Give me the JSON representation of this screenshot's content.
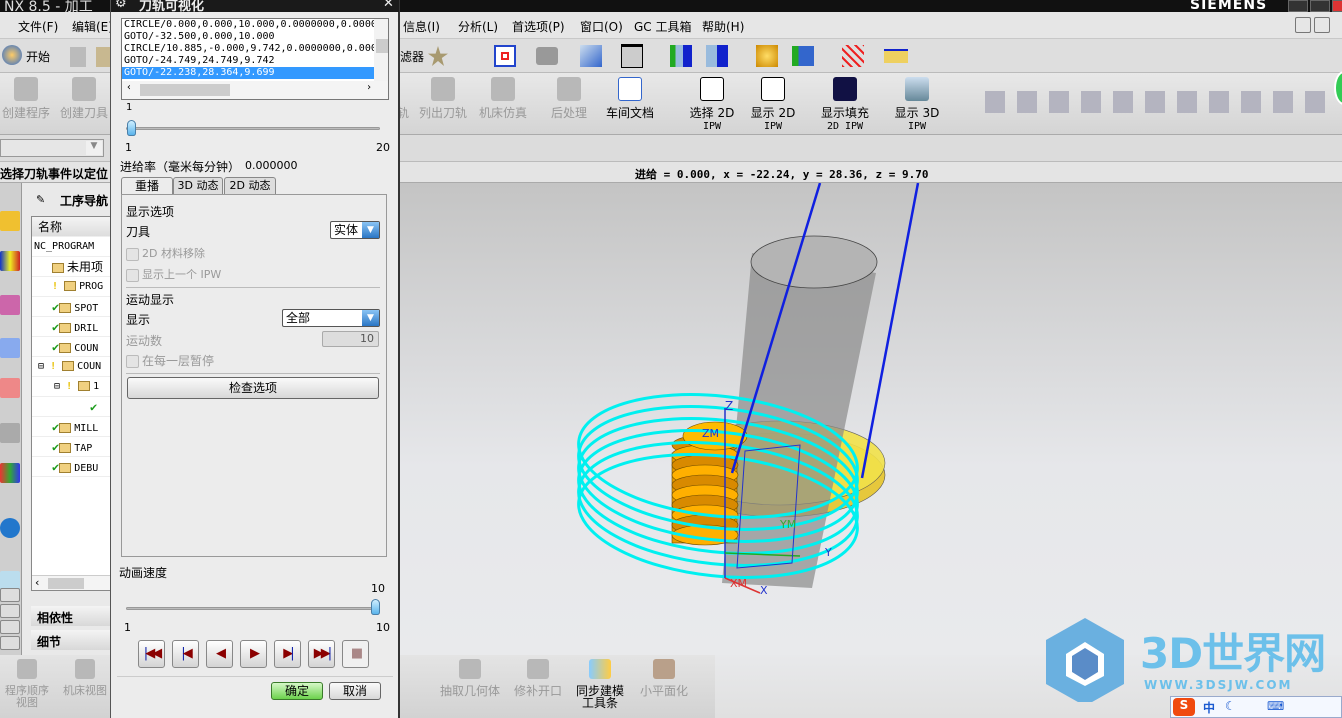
{
  "window": {
    "title": "NX 8.5 - 加工",
    "brand": "SIEMENS"
  },
  "menu": [
    "文件(F)",
    "编辑(E)",
    "信息(I)",
    "分析(L)",
    "首选项(P)",
    "窗口(O)",
    "GC 工具箱",
    "帮助(H)"
  ],
  "toolbar1": {
    "start": "开始",
    "filter_fragment": "滤器"
  },
  "toolbar2": {
    "items": [
      {
        "label": "创建程序",
        "enabled": false
      },
      {
        "label": "创建刀具",
        "enabled": false
      },
      {
        "label": "轨",
        "enabled": false
      },
      {
        "label": "列出刀轨",
        "enabled": false
      },
      {
        "label": "机床仿真",
        "enabled": false
      },
      {
        "label": "后处理",
        "enabled": false
      },
      {
        "label": "车间文档",
        "enabled": true
      },
      {
        "label": "选择 2D",
        "label2": "IPW",
        "enabled": true
      },
      {
        "label": "显示 2D",
        "label2": "IPW",
        "enabled": true
      },
      {
        "label": "显示填充",
        "label2": "2D IPW",
        "enabled": true
      },
      {
        "label": "显示 3D",
        "label2": "IPW",
        "enabled": true
      }
    ]
  },
  "status": {
    "prompt": "选择刀轨事件以定位",
    "readout": "进给 = 0.000, x = -22.24, y = 28.36, z = 9.70"
  },
  "navigator": {
    "title": "工序导航",
    "column": "名称",
    "rows": [
      {
        "text": "NC_PROGRAM",
        "icon": "none"
      },
      {
        "text": "未用项",
        "icon": "folder"
      },
      {
        "text": "PROG",
        "icon": "bulb"
      },
      {
        "text": "SPOT",
        "icon": "check"
      },
      {
        "text": "DRIL",
        "icon": "check"
      },
      {
        "text": "COUN",
        "icon": "check"
      },
      {
        "text": "COUN",
        "icon": "bulb"
      },
      {
        "text": "1",
        "icon": "bulb"
      },
      {
        "text": "",
        "icon": "check"
      },
      {
        "text": "MILL",
        "icon": "check"
      },
      {
        "text": "TAP",
        "icon": "check"
      },
      {
        "text": "DEBU",
        "icon": "check"
      }
    ],
    "dependency": "相依性",
    "details": "细节"
  },
  "dialog": {
    "title": "刀轨可视化",
    "lines": [
      "CIRCLE/0.000,0.000,10.000,0.0000000,0.0000",
      "GOTO/-32.500,0.000,10.000",
      "CIRCLE/10.885,-0.000,9.742,0.0000000,0.000",
      "GOTO/-24.749,24.749,9.742",
      "GOTO/-22.238,28.364,9.699"
    ],
    "selected_line": 4,
    "motion_slider": {
      "value": "1",
      "min": "1",
      "max": "20"
    },
    "feed_label": "进给率（毫米每分钟）",
    "feed_value": "0.000000",
    "tabs": [
      "重播",
      "3D 动态",
      "2D 动态"
    ],
    "active_tab": 0,
    "display_options": "显示选项",
    "tool_label": "刀具",
    "tool_value": "实体",
    "cb_2d_removal": "2D 材料移除",
    "cb_prev_ipw": "显示上一个 IPW",
    "motion_display": "运动显示",
    "display_label": "显示",
    "display_value": "全部",
    "motion_count_label": "运动数",
    "motion_count": "10",
    "cb_pause": "在每一层暂停",
    "check_options": "检查选项",
    "speed_label": "动画速度",
    "speed_slider": {
      "value": "10",
      "min": "1",
      "max": "10"
    },
    "ok": "确定",
    "cancel": "取消"
  },
  "bottom_toolbar": {
    "left": [
      "程序顺序视图",
      "机床视图"
    ],
    "items": [
      "抽取几何体",
      "修补开口",
      "同步建模工具条",
      "小平面化"
    ]
  },
  "viewport": {
    "labels": {
      "z": "Z",
      "zm": "ZM",
      "ym": "YM",
      "xm": "XM",
      "x": "X",
      "y": "Y"
    }
  },
  "watermark": {
    "title": "3D世界网",
    "url": "WWW.3DSJW.COM"
  },
  "ime": "中"
}
